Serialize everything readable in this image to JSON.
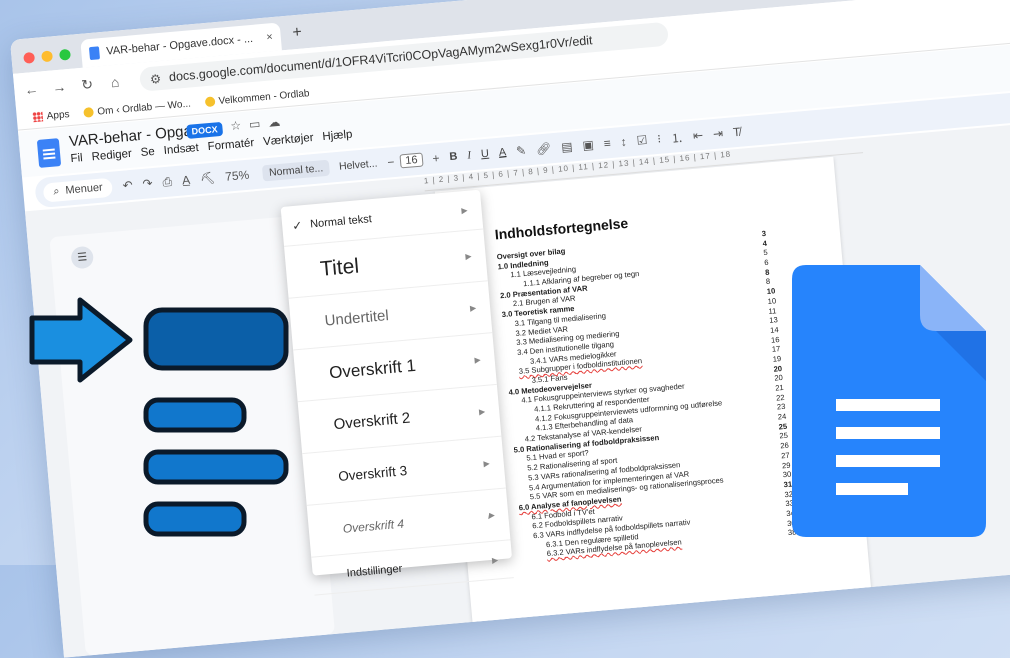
{
  "browser": {
    "tab_title": "VAR-behar - Opgave.docx - ...",
    "tab_close": "×",
    "new_tab": "+",
    "url": "docs.google.com/document/d/1OFR4ViTcri0COpVagAMym2wSexg1r0Vr/edit",
    "bookmarks": [
      {
        "label": "Apps"
      },
      {
        "label": "Om ‹ Ordlab — Wo..."
      },
      {
        "label": "Velkommen - Ordlab"
      }
    ]
  },
  "docs": {
    "title": "VAR-behar - Opgave",
    "badge": "DOCX",
    "menu": [
      "Fil",
      "Rediger",
      "Se",
      "Indsæt",
      "Formatér",
      "Værktøjer",
      "Hjælp"
    ],
    "toolbar": {
      "search_label": "Menuer",
      "zoom": "75%",
      "style_select": "Normal te...",
      "font": "Helvet...",
      "font_size": "16",
      "bold": "B",
      "italic": "I",
      "underline": "U",
      "text_color": "A"
    },
    "ruler_text": "1 | 2 | 3 | 4 | 5 | 6 | 7 | 8 | 9 | 10 | 11 | 12 | 13 | 14 | 15 | 16 | 17 | 18"
  },
  "style_menu": {
    "items": [
      {
        "label": "Normal tekst",
        "checked": true
      },
      {
        "label": "Titel"
      },
      {
        "label": "Undertitel"
      },
      {
        "label": "Overskrift 1"
      },
      {
        "label": "Overskrift 2"
      },
      {
        "label": "Overskrift 3"
      },
      {
        "label": "Overskrift 4"
      },
      {
        "label": "Indstillinger"
      }
    ]
  },
  "toc": {
    "title": "Indholdsfortegnelse",
    "rows": [
      {
        "text": "Oversigt over bilag",
        "page": "3",
        "level": 1,
        "bold": true
      },
      {
        "text": "1.0 Indledning",
        "page": "4",
        "level": 1,
        "bold": true
      },
      {
        "text": "1.1 Læsevejledning",
        "page": "5",
        "level": 2
      },
      {
        "text": "1.1.1 Afklaring af begreber og tegn",
        "page": "6",
        "level": 3
      },
      {
        "text": "2.0 Præsentation af VAR",
        "page": "8",
        "level": 1,
        "bold": true
      },
      {
        "text": "2.1 Brugen af VAR",
        "page": "8",
        "level": 2
      },
      {
        "text": "3.0 Teoretisk ramme",
        "page": "10",
        "level": 1,
        "bold": true
      },
      {
        "text": "3.1 Tilgang til medialisering",
        "page": "10",
        "level": 2
      },
      {
        "text": "3.2 Mediet VAR",
        "page": "11",
        "level": 2
      },
      {
        "text": "3.3 Medialisering og mediering",
        "page": "13",
        "level": 2
      },
      {
        "text": "3.4 Den institutionelle tilgang",
        "page": "14",
        "level": 2
      },
      {
        "text": "3.4.1 VARs medielogikker",
        "page": "16",
        "level": 3
      },
      {
        "text": "3.5 Subgrupper i fodboldinstitutionen",
        "page": "17",
        "level": 2,
        "spell": true
      },
      {
        "text": "3.5.1 Fans",
        "page": "19",
        "level": 3
      },
      {
        "text": "4.0 Metodeovervejelser",
        "page": "20",
        "level": 1,
        "bold": true
      },
      {
        "text": "4.1 Fokusgruppeinterviews styrker og svagheder",
        "page": "20",
        "level": 2
      },
      {
        "text": "4.1.1 Rekruttering af respondenter",
        "page": "21",
        "level": 3
      },
      {
        "text": "4.1.2 Fokusgruppeinterviewets udformning og udførelse",
        "page": "22",
        "level": 3
      },
      {
        "text": "4.1.3 Efterbehandling af data",
        "page": "23",
        "level": 3
      },
      {
        "text": "4.2 Tekstanalyse af VAR-kendelser",
        "page": "24",
        "level": 2
      },
      {
        "text": "5.0 Rationalisering af fodboldpraksissen",
        "page": "25",
        "level": 1,
        "bold": true
      },
      {
        "text": "5.1 Hvad er sport?",
        "page": "25",
        "level": 2
      },
      {
        "text": "5.2 Rationalisering af sport",
        "page": "26",
        "level": 2
      },
      {
        "text": "5.3 VARs rationalisering af fodboldpraksissen",
        "page": "27",
        "level": 2
      },
      {
        "text": "5.4 Argumentation for implementeringen af VAR",
        "page": "29",
        "level": 2
      },
      {
        "text": "5.5 VAR som en medialiserings- og rationaliseringsproces",
        "page": "30",
        "level": 2
      },
      {
        "text": "6.0 Analyse af fanoplevelsen",
        "page": "31",
        "level": 1,
        "bold": true,
        "spell": true
      },
      {
        "text": "6.1 Fodbold i TV'et",
        "page": "32",
        "level": 2
      },
      {
        "text": "6.2 Fodboldspillets narrativ",
        "page": "33",
        "level": 2
      },
      {
        "text": "6.3 VARs indflydelse på fodboldspillets narrativ",
        "page": "34",
        "level": 2
      },
      {
        "text": "6.3.1 Den regulære spilletid",
        "page": "36",
        "level": 3
      },
      {
        "text": "6.3.2 VARs indflydelse på fanoplevelsen",
        "page": "38",
        "level": 3,
        "spell": true
      }
    ]
  },
  "colors": {
    "accent": "#1a73e8",
    "arrow_blue": "#1a8fe0",
    "block_dark": "#0b5fa8",
    "block_mid": "#1177cc",
    "docs_blue": "#2684fc",
    "docs_light": "#8ab4f8"
  }
}
